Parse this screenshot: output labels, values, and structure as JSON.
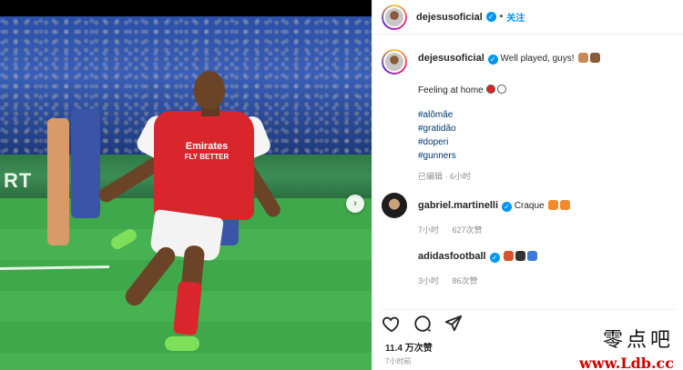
{
  "post": {
    "author": "dejesusoficial",
    "follow_label": "关注",
    "dot": "•",
    "photo_board_text": "RT"
  },
  "caption": {
    "username": "dejesusoficial",
    "text": "Well played, guys!",
    "line2": "Feeling at home",
    "hashtags": [
      "#alômãe",
      "#gratidão",
      "#doperi",
      "#gunners"
    ],
    "meta": "已编辑 · 6小时"
  },
  "comments": [
    {
      "username": "gabriel.martinelli",
      "text": "Craque",
      "time": "7小时",
      "likes": "627次赞"
    },
    {
      "username": "adidasfootball",
      "text": "",
      "time": "3小时",
      "likes": "86次赞"
    }
  ],
  "player": {
    "sponsor_line1": "Emirates",
    "sponsor_line2": "FLY BETTER"
  },
  "actions": {
    "likes_count": "11.4 万次赞",
    "posted": "7小时前"
  },
  "watermark": {
    "chinese": "零点吧",
    "url": "www.Ldb.cc"
  },
  "colors": {
    "link_blue": "#0095f6",
    "hashtag": "#00376b",
    "arsenal_red": "#d8262c",
    "pitch": "#3ea84a"
  }
}
